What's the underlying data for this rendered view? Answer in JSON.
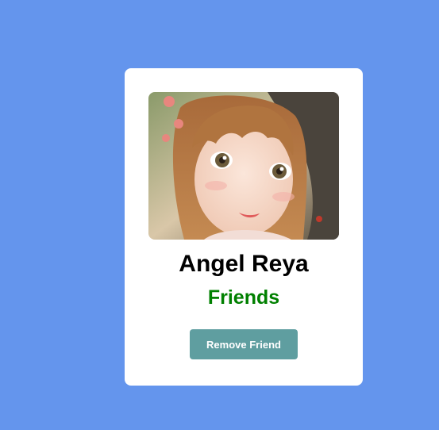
{
  "profile": {
    "name": "Angel Reya",
    "status": "Friends",
    "action_label": "Remove Friend",
    "avatar_icon": "profile-photo"
  },
  "colors": {
    "background": "#6495ED",
    "card": "#FFFFFF",
    "status": "#008000",
    "button": "#5F9EA0",
    "button_text": "#FFFFFF"
  }
}
